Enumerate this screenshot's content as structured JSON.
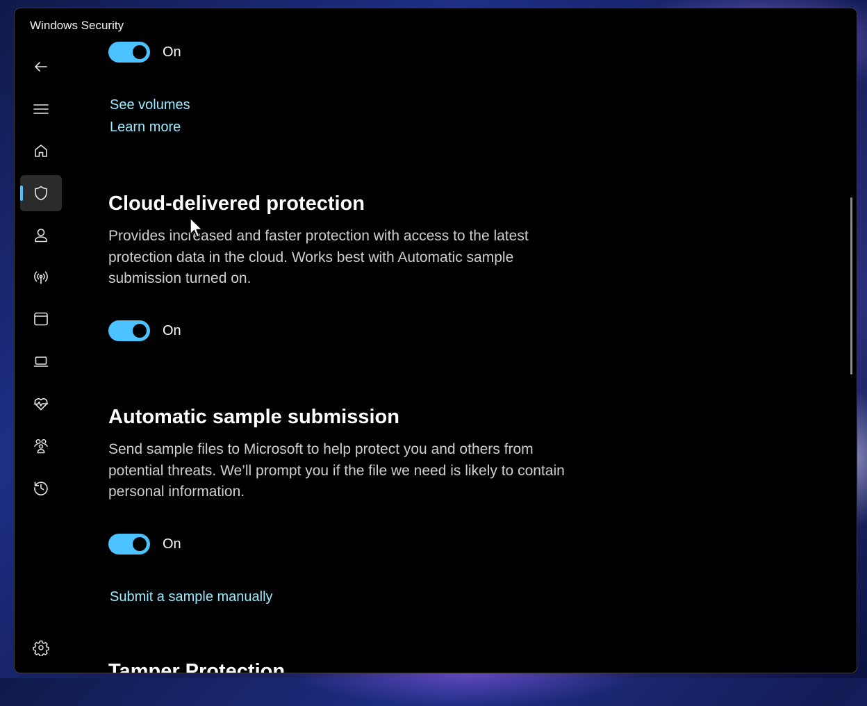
{
  "window": {
    "title": "Windows Security"
  },
  "nav": {
    "items": [
      {
        "icon": "back-arrow-icon"
      },
      {
        "icon": "hamburger-menu-icon"
      },
      {
        "icon": "home-icon"
      },
      {
        "icon": "shield-icon",
        "selected": true
      },
      {
        "icon": "account-person-icon"
      },
      {
        "icon": "network-antenna-icon"
      },
      {
        "icon": "app-browser-icon"
      },
      {
        "icon": "laptop-device-icon"
      },
      {
        "icon": "heart-pulse-icon"
      },
      {
        "icon": "family-icon"
      },
      {
        "icon": "history-clock-icon"
      },
      {
        "icon": "settings-gear-icon"
      }
    ],
    "accent": "#4cc2ff"
  },
  "sections": {
    "top": {
      "toggle_label": "On",
      "links": [
        "See volumes",
        "Learn more"
      ]
    },
    "cloud": {
      "heading": "Cloud-delivered protection",
      "description_lines": [
        "Provides increased and faster protection with access to the latest",
        "protection data in the cloud. Works best with Automatic sample",
        "submission turned on."
      ],
      "toggle_label": "On"
    },
    "sample": {
      "heading": "Automatic sample submission",
      "description_lines": [
        "Send sample files to Microsoft to help protect you and others from",
        "potential threats. We’ll prompt you if the file we need is likely to contain",
        "personal information."
      ],
      "toggle_label": "On",
      "link": "Submit a sample manually"
    },
    "tamper": {
      "heading": "Tamper Protection"
    }
  },
  "colors": {
    "toggle_on": "#4cc2ff",
    "link": "#99ebff",
    "description": "#cfcfcf",
    "background": "#000000"
  }
}
